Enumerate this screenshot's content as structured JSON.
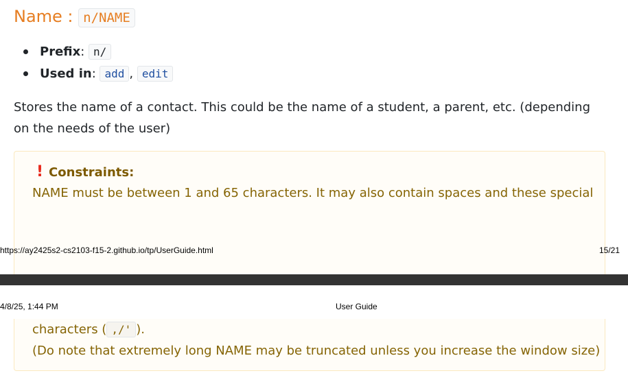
{
  "section": {
    "title_prefix": "Name : ",
    "title_code": "n/NAME",
    "properties": [
      {
        "term": "Prefix",
        "sep": ": ",
        "codes": [
          "n/"
        ]
      },
      {
        "term": "Used in",
        "sep": ": ",
        "codes": [
          "add",
          "edit"
        ]
      }
    ],
    "description": "Stores the name of a contact. This could be the name of a student, a parent, etc. (depending on the needs of the user)"
  },
  "constraints": {
    "icon": "exclamation-icon",
    "title": "Constraints:",
    "line1": "NAME must be between 1 and 65 characters. It may also contain spaces and these special",
    "line2_prefix": "characters (",
    "line2_code": ",/'",
    "line2_suffix": ").",
    "line3": "(Do note that extremely long NAME may be truncated unless you increase the window size)"
  },
  "print": {
    "footer_url": "https://ay2425s2-cs2103-f15-2.github.io/tp/UserGuide.html",
    "footer_page": "15/21",
    "header_date": "4/8/25, 1:44 PM",
    "header_title": "User Guide"
  }
}
